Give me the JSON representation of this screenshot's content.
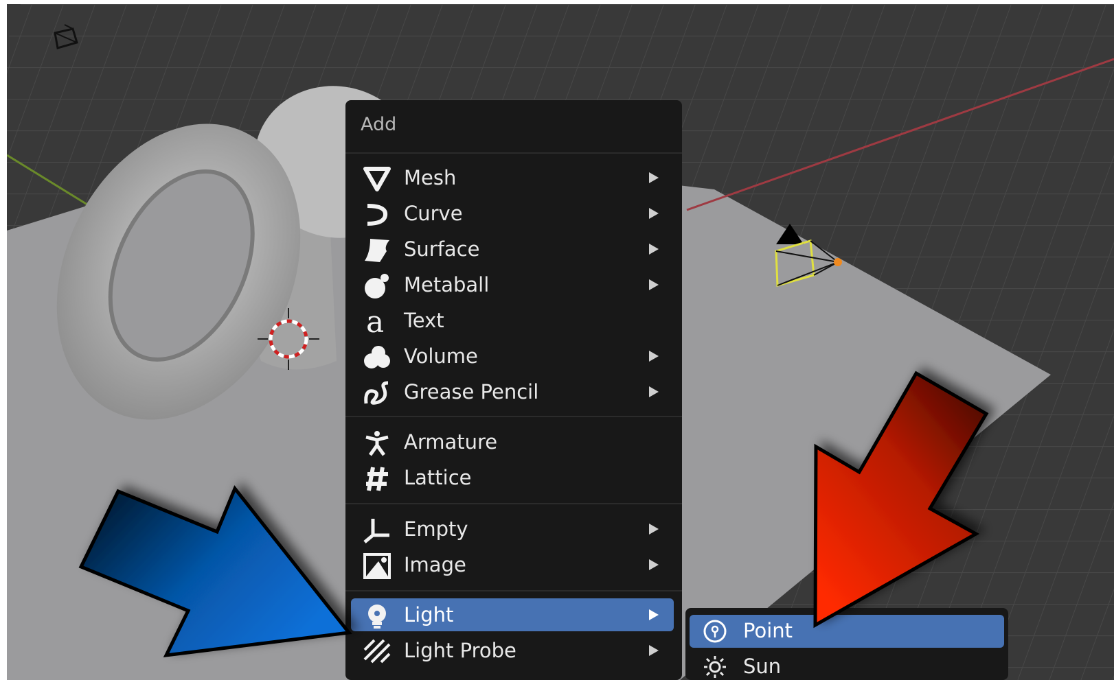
{
  "viewport": {
    "camera_toggle_icon": "camera-view-icon"
  },
  "add_menu": {
    "title": "Add",
    "groups": [
      [
        {
          "label": "Mesh",
          "icon": "mesh-icon",
          "submenu": true
        },
        {
          "label": "Curve",
          "icon": "curve-icon",
          "submenu": true
        },
        {
          "label": "Surface",
          "icon": "surface-icon",
          "submenu": true
        },
        {
          "label": "Metaball",
          "icon": "metaball-icon",
          "submenu": true
        },
        {
          "label": "Text",
          "icon": "text-icon",
          "submenu": false
        },
        {
          "label": "Volume",
          "icon": "volume-icon",
          "submenu": true
        },
        {
          "label": "Grease Pencil",
          "icon": "grease-pencil-icon",
          "submenu": true
        }
      ],
      [
        {
          "label": "Armature",
          "icon": "armature-icon",
          "submenu": false
        },
        {
          "label": "Lattice",
          "icon": "lattice-icon",
          "submenu": false
        }
      ],
      [
        {
          "label": "Empty",
          "icon": "empty-icon",
          "submenu": true
        },
        {
          "label": "Image",
          "icon": "image-icon",
          "submenu": true
        }
      ],
      [
        {
          "label": "Light",
          "icon": "light-icon",
          "submenu": true,
          "highlighted": true
        },
        {
          "label": "Light Probe",
          "icon": "light-probe-icon",
          "submenu": true
        }
      ]
    ]
  },
  "light_submenu": {
    "items": [
      {
        "label": "Point",
        "icon": "point-light-icon",
        "highlighted": true
      },
      {
        "label": "Sun",
        "icon": "sun-light-icon"
      }
    ]
  },
  "colors": {
    "menu_bg": "#181818",
    "highlight": "#4772b3",
    "viewport_bg": "#3b3b3b",
    "floor": "#9a9a9c",
    "blue_arrow": "#0a6fd6",
    "red_arrow": "#ff2a00"
  }
}
